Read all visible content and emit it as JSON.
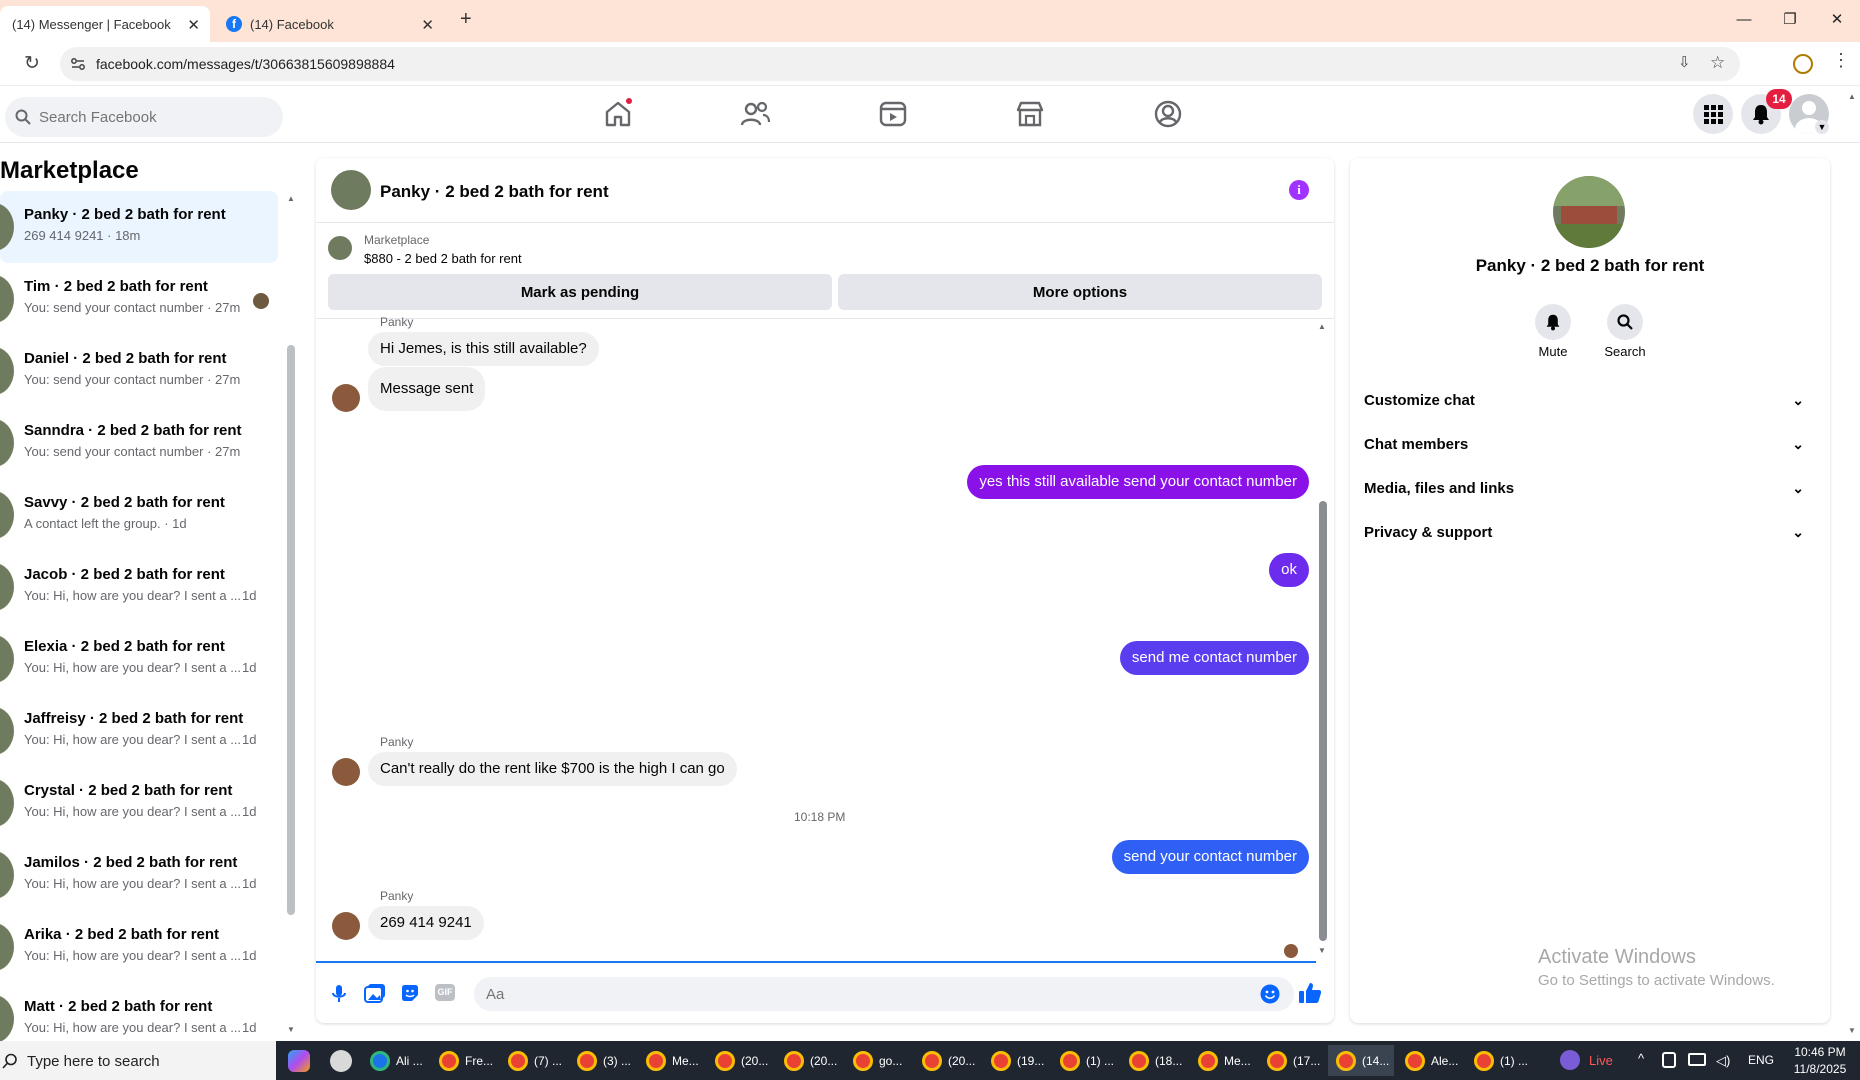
{
  "browser": {
    "tabs": [
      {
        "title": "(14) Messenger | Facebook"
      },
      {
        "title": "(14) Facebook"
      }
    ],
    "url": "facebook.com/messages/t/30663815609898884"
  },
  "header": {
    "search_placeholder": "Search Facebook",
    "notification_count": "14"
  },
  "sidebar": {
    "title": "Marketplace",
    "conversations": [
      {
        "name": "Panky · 2 bed 2 bath for rent",
        "preview": "269 414 9241 · 18m",
        "time": ""
      },
      {
        "name": "Tim · 2 bed 2 bath for rent",
        "preview": "You: send your contact number · 27m",
        "time": ""
      },
      {
        "name": "Daniel · 2 bed 2 bath for rent",
        "preview": "You: send your contact number · 27m",
        "time": ""
      },
      {
        "name": "Sanndra · 2 bed 2 bath for rent",
        "preview": "You: send your contact number · 27m",
        "time": ""
      },
      {
        "name": "Savvy · 2 bed 2 bath for rent",
        "preview": "A contact left the group. · 1d",
        "time": ""
      },
      {
        "name": "Jacob · 2 bed 2 bath for rent",
        "preview": "You: Hi, how are you dear? I sent a ...",
        "time": "1d"
      },
      {
        "name": "Elexia · 2 bed 2 bath for rent",
        "preview": "You: Hi, how are you dear? I sent a ...",
        "time": "1d"
      },
      {
        "name": "Jaffreisy · 2 bed 2 bath for rent",
        "preview": "You: Hi, how are you dear? I sent a ...",
        "time": "1d"
      },
      {
        "name": "Crystal · 2 bed 2 bath for rent",
        "preview": "You: Hi, how are you dear? I sent a ...",
        "time": "1d"
      },
      {
        "name": "Jamilos · 2 bed 2 bath for rent",
        "preview": "You: Hi, how are you dear? I sent a ...",
        "time": "1d"
      },
      {
        "name": "Arika · 2 bed 2 bath for rent",
        "preview": "You: Hi, how are you dear? I sent a ...",
        "time": "1d"
      },
      {
        "name": "Matt · 2 bed 2 bath for rent",
        "preview": "You: Hi, how are you dear? I sent a ...",
        "time": "1d"
      }
    ]
  },
  "chat": {
    "title": "Panky · 2 bed 2 bath for rent",
    "listing_label": "Marketplace",
    "listing_price": "$880 - 2 bed 2 bath for rent",
    "mark_pending": "Mark as pending",
    "more_options": "More options",
    "sender_top": "Panky",
    "msg1": "Hi Jemes, is this still available?",
    "msg2": "Message sent",
    "msg3": "yes this still available send your contact number",
    "msg4": "ok",
    "msg5": "send me contact number",
    "sender_mid": "Panky",
    "msg6": "Can't really do the rent like $700 is the high I can go",
    "timestamp": "10:18 PM",
    "msg7": "send your contact number",
    "sender_bot": "Panky",
    "msg8": "269 414 9241",
    "composer_placeholder": "Aa",
    "colors": {
      "bubble_purple": "#8a11e8",
      "bubble_violet": "#5b3df0",
      "bubble_blue": "#2f5ff5"
    }
  },
  "info": {
    "name": "Panky · 2 bed 2 bath for rent",
    "mute": "Mute",
    "search": "Search",
    "rows": [
      "Customize chat",
      "Chat members",
      "Media, files and links",
      "Privacy & support"
    ]
  },
  "watermark": {
    "line1": "Activate Windows",
    "line2": "Go to Settings to activate Windows."
  },
  "taskbar": {
    "search_placeholder": "Type here to search",
    "apps": [
      "Ali ...",
      "Fre...",
      "(7) ...",
      "(3) ...",
      "Me...",
      "(20...",
      "(20...",
      "go...",
      "(20...",
      "(19...",
      "(1) ...",
      "(18...",
      "Me...",
      "(17...",
      "(14...",
      "Ale...",
      "(1) ..."
    ],
    "live": "Live",
    "lang": "ENG",
    "time": "10:46 PM",
    "date": "11/8/2025"
  }
}
